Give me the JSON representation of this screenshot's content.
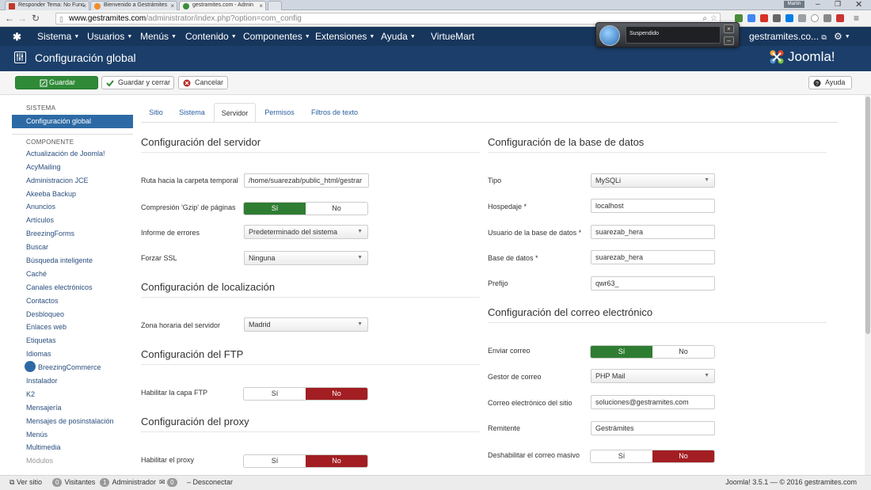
{
  "browser": {
    "tabs": [
      {
        "title": "Responder Tema: No Func",
        "active": false
      },
      {
        "title": "Bienvenido a Gestrámites",
        "active": false
      },
      {
        "title": "gestramites.com - Admin",
        "active": true
      }
    ],
    "window_badge": "Martin",
    "url_host": "www.gestramites.com",
    "url_path": "/administrator/index.php?option=com_config"
  },
  "topnav": {
    "menus": [
      "Sistema",
      "Usuarios",
      "Menús",
      "Contenido",
      "Componentes",
      "Extensiones",
      "Ayuda"
    ],
    "virtuemart": "VirtueMart",
    "site": "gestramites.co..."
  },
  "popup": {
    "text": "Suspendido"
  },
  "header": {
    "title": "Configuración global",
    "brand": "Joomla!"
  },
  "toolbar": {
    "save": "Guardar",
    "save_close": "Guardar y cerrar",
    "cancel": "Cancelar",
    "help": "Ayuda"
  },
  "sidebar": {
    "system_heading": "SISTEMA",
    "system_item": "Configuración global",
    "component_heading": "COMPONENTE",
    "items": [
      "Actualización de Joomla!",
      "AcyMailing",
      "Administracion JCE",
      "Akeeba Backup",
      "Anuncios",
      "Artículos",
      "BreezingForms",
      "Buscar",
      "Búsqueda inteligente",
      "Caché",
      "Canales electrónicos",
      "Contactos",
      "Desbloqueo",
      "Enlaces web",
      "Etiquetas",
      "Idiomas",
      "BreezingCommerce",
      "Instalador",
      "K2",
      "Mensajería",
      "Mensajes de posinstalación",
      "Menús",
      "Multimedia",
      "Módulos"
    ]
  },
  "tabs": [
    "Sitio",
    "Sistema",
    "Servidor",
    "Permisos",
    "Filtros de texto"
  ],
  "left": {
    "server": {
      "title": "Configuración del servidor",
      "tmp_label": "Ruta hacia la carpeta temporal",
      "tmp_value": "/home/suarezab/public_html/gestrar",
      "gzip_label": "Compresión 'Gzip' de páginas",
      "errors_label": "Informe de errores",
      "errors_value": "Predeterminado del sistema",
      "ssl_label": "Forzar SSL",
      "ssl_value": "Ninguna"
    },
    "locale": {
      "title": "Configuración de localización",
      "tz_label": "Zona horaria del servidor",
      "tz_value": "Madrid"
    },
    "ftp": {
      "title": "Configuración del FTP",
      "enable_label": "Habilitar la capa FTP"
    },
    "proxy": {
      "title": "Configuración del proxy",
      "enable_label": "Habilitar el proxy"
    }
  },
  "right": {
    "db": {
      "title": "Configuración de la base de datos",
      "type_label": "Tipo",
      "type_value": "MySQLi",
      "host_label": "Hospedaje *",
      "host_value": "localhost",
      "user_label": "Usuario de la base de datos *",
      "user_value": "suarezab_hera",
      "name_label": "Base de datos *",
      "name_value": "suarezab_hera",
      "prefix_label": "Prefijo",
      "prefix_value": "qwr63_"
    },
    "mail": {
      "title": "Configuración del correo electrónico",
      "send_label": "Enviar correo",
      "mailer_label": "Gestor de correo",
      "mailer_value": "PHP Mail",
      "from_label": "Correo electrónico del sitio",
      "from_value": "soluciones@gestramites.com",
      "sender_label": "Remitente",
      "sender_value": "Gestrámites",
      "mass_label": "Deshabilitar el correo masivo"
    }
  },
  "toggle": {
    "yes": "Sí",
    "no": "No"
  },
  "status": {
    "view_site": "Ver sitio",
    "visitors_count": "0",
    "visitors": "Visitantes",
    "admins_count": "1",
    "admins": "Administrador",
    "messages_count": "0",
    "logout": "Desconectar",
    "version": "Joomla! 3.5.1 — © 2016 gestramites.com"
  },
  "colors": {
    "nav": "#17365c",
    "header": "#1b3f6a",
    "yes_green": "#2f7d32",
    "no_red": "#a31e22",
    "link": "#2a5fa0"
  }
}
